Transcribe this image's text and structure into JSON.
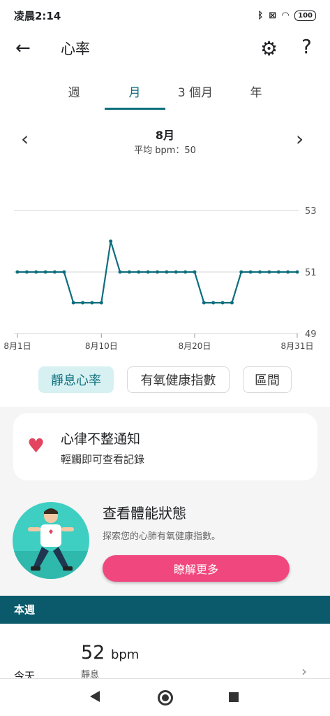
{
  "status_bar": {
    "time": "凌晨2:14",
    "bluetooth_icon": "bluetooth-icon",
    "wifi_icon": "wifi-icon",
    "battery": "100"
  },
  "appbar": {
    "title": "心率"
  },
  "tabs": [
    {
      "label": "週",
      "active": false
    },
    {
      "label": "月",
      "active": true
    },
    {
      "label": "3 個月",
      "active": false
    },
    {
      "label": "年",
      "active": false
    }
  ],
  "period": {
    "title": "8月",
    "subtitle": "平均 bpm：50"
  },
  "chart_data": {
    "type": "line",
    "x": [
      1,
      2,
      3,
      4,
      5,
      6,
      7,
      8,
      9,
      10,
      11,
      12,
      13,
      14,
      15,
      16,
      17,
      18,
      19,
      20,
      21,
      22,
      23,
      24,
      25,
      26,
      27,
      28,
      29,
      30,
      31
    ],
    "y": [
      51,
      51,
      51,
      51,
      51,
      51,
      50,
      50,
      50,
      50,
      52,
      51,
      51,
      51,
      51,
      51,
      51,
      51,
      51,
      51,
      50,
      50,
      50,
      50,
      51,
      51,
      51,
      51,
      51,
      51,
      51
    ],
    "x_tick_labels": [
      "8月1日",
      "8月10日",
      "8月20日",
      "8月31日"
    ],
    "x_ticks": [
      1,
      10,
      20,
      31
    ],
    "y_tick_labels": [
      "53",
      "51",
      "49"
    ],
    "y_ticks": [
      53,
      51,
      49
    ],
    "ylim": [
      49,
      53
    ],
    "color": "#0d6e7d"
  },
  "filters": [
    {
      "label": "靜息心率",
      "active": true
    },
    {
      "label": "有氧健康指數",
      "active": false
    },
    {
      "label": "區間",
      "active": false
    }
  ],
  "notify_card": {
    "title": "心律不整通知",
    "subtitle": "輕觸即可查看記錄"
  },
  "fitness_card": {
    "title": "查看體能狀態",
    "subtitle": "探索您的心肺有氧健康指數。",
    "button": "瞭解更多"
  },
  "week_section": {
    "header": "本週",
    "row_value": "52",
    "row_unit": "bpm",
    "row_label": "靜息",
    "row_day": "今天"
  },
  "colors": {
    "accent": "#0d6e7d",
    "pink": "#f0477e",
    "heart": "#e3445f",
    "header_bg": "#0a5a6b"
  }
}
